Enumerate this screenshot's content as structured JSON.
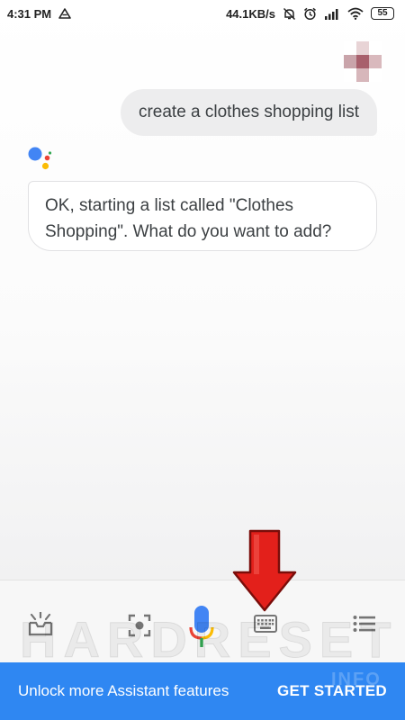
{
  "status_bar": {
    "time": "4:31 PM",
    "network_speed": "44.1KB/s",
    "battery": "55",
    "icons": [
      "drive-notification-icon",
      "mute-icon",
      "alarm-icon",
      "signal-icon",
      "wifi-icon",
      "battery-icon"
    ]
  },
  "conversation": {
    "user_message": "create a clothes shopping list",
    "assistant_line1": "OK, starting a list called \"Clothes",
    "assistant_line2": "Shopping\". What do you want to add?"
  },
  "bottom_bar": {
    "icons": [
      "updates-tray-icon",
      "lens-icon",
      "microphone-icon",
      "keyboard-icon",
      "explore-list-icon"
    ]
  },
  "annotation": {
    "arrow_color": "#e3201b"
  },
  "watermark": {
    "main": "HARDRESET",
    "sub": "INFO"
  },
  "banner": {
    "text": "Unlock more Assistant features",
    "button": "GET STARTED",
    "color": "#2f87f2"
  },
  "colors": {
    "google_blue": "#4285f4",
    "google_red": "#ea4335",
    "google_yellow": "#fbbc05",
    "google_green": "#34a853"
  }
}
